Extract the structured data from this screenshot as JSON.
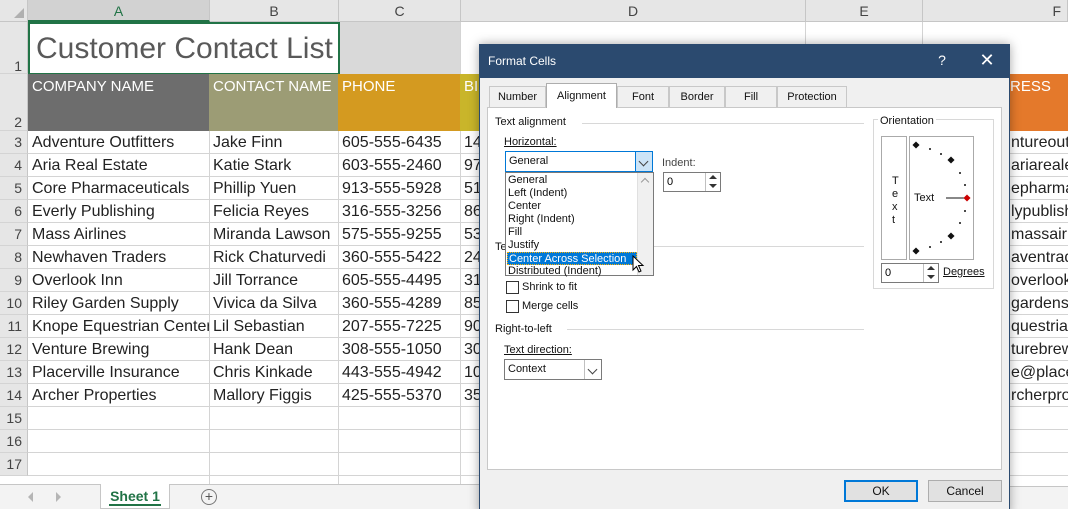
{
  "sheet": {
    "columns": [
      "A",
      "B",
      "C",
      "D",
      "E",
      "F"
    ],
    "rows": [
      "1",
      "2",
      "3",
      "4",
      "5",
      "6",
      "7",
      "8",
      "9",
      "10",
      "11",
      "12",
      "13",
      "14",
      "15",
      "16",
      "17"
    ],
    "title": "Customer Contact List",
    "headers": {
      "company": "COMPANY NAME",
      "contact": "CONTACT NAME",
      "phone": "PHONE",
      "partial_d": "BI",
      "partial_f": "RESS"
    },
    "colors": {
      "company_header": "#6d6d6d",
      "contact_header": "#9c9c75",
      "phone_header": "#d49a20",
      "col_d_header": "#c9b52a",
      "col_f_header": "#e4792b",
      "title_band": "#d9d9d9",
      "accent_green": "#217346"
    },
    "data": [
      {
        "company": "Adventure Outfitters",
        "contact": "Jake Finn",
        "phone": "605-555-6435",
        "d": "14",
        "f": "ntureoutf"
      },
      {
        "company": "Aria Real Estate",
        "contact": "Katie Stark",
        "phone": "603-555-2460",
        "d": "97",
        "f": "ariareale"
      },
      {
        "company": "Core Pharmaceuticals",
        "contact": "Phillip Yuen",
        "phone": "913-555-5928",
        "d": "51",
        "f": "epharma"
      },
      {
        "company": "Everly Publishing",
        "contact": "Felicia Reyes",
        "phone": "316-555-3256",
        "d": "86",
        "f": "lypublish"
      },
      {
        "company": "Mass Airlines",
        "contact": "Miranda Lawson",
        "phone": "575-555-9255",
        "d": "53",
        "f": "massairli"
      },
      {
        "company": "Newhaven Traders",
        "contact": "Rick Chaturvedi",
        "phone": "360-555-5422",
        "d": "24",
        "f": "aventrad"
      },
      {
        "company": "Overlook Inn",
        "contact": "Jill Torrance",
        "phone": "605-555-4495",
        "d": "31",
        "f": "overlooki"
      },
      {
        "company": "Riley Garden Supply",
        "contact": "Vivica da Silva",
        "phone": "360-555-4289",
        "d": "85",
        "f": "gardensu"
      },
      {
        "company": "Knope Equestrian Center",
        "contact": "Lil Sebastian",
        "phone": "207-555-7225",
        "d": "90",
        "f": "questrian"
      },
      {
        "company": "Venture Brewing",
        "contact": "Hank Dean",
        "phone": "308-555-1050",
        "d": "30",
        "f": "turebrew"
      },
      {
        "company": "Placerville Insurance",
        "contact": "Chris Kinkade",
        "phone": "443-555-4942",
        "d": "10",
        "f": "e@place"
      },
      {
        "company": "Archer Properties",
        "contact": "Mallory Figgis",
        "phone": "425-555-5370",
        "d": "35",
        "f": "rcherpro"
      }
    ],
    "sheet_tab": "Sheet 1",
    "add_sheet_icon": "plus-circle-icon"
  },
  "dialog": {
    "title": "Format Cells",
    "help": "?",
    "close": "✕",
    "tabs": [
      "Number",
      "Alignment",
      "Font",
      "Border",
      "Fill",
      "Protection"
    ],
    "active_tab": "Alignment",
    "text_alignment_label": "Text alignment",
    "horizontal_label": "Horizontal:",
    "horizontal_value": "General",
    "horizontal_options": [
      "General",
      "Left (Indent)",
      "Center",
      "Right (Indent)",
      "Fill",
      "Justify",
      "Center Across Selection",
      "Distributed (Indent)"
    ],
    "highlighted_option": "Center Across Selection",
    "indent_label": "Indent:",
    "indent_value": "0",
    "text_control_partial": "Te",
    "shrink_label": "Shrink to fit",
    "merge_label": "Merge cells",
    "rtl_label": "Right-to-left",
    "text_direction_label": "Text direction:",
    "text_direction_value": "Context",
    "orientation_label": "Orientation",
    "vertical_text": [
      "T",
      "e",
      "x",
      "t"
    ],
    "dial_text": "Text",
    "degrees_value": "0",
    "degrees_label": "Degrees",
    "ok": "OK",
    "cancel": "Cancel"
  }
}
